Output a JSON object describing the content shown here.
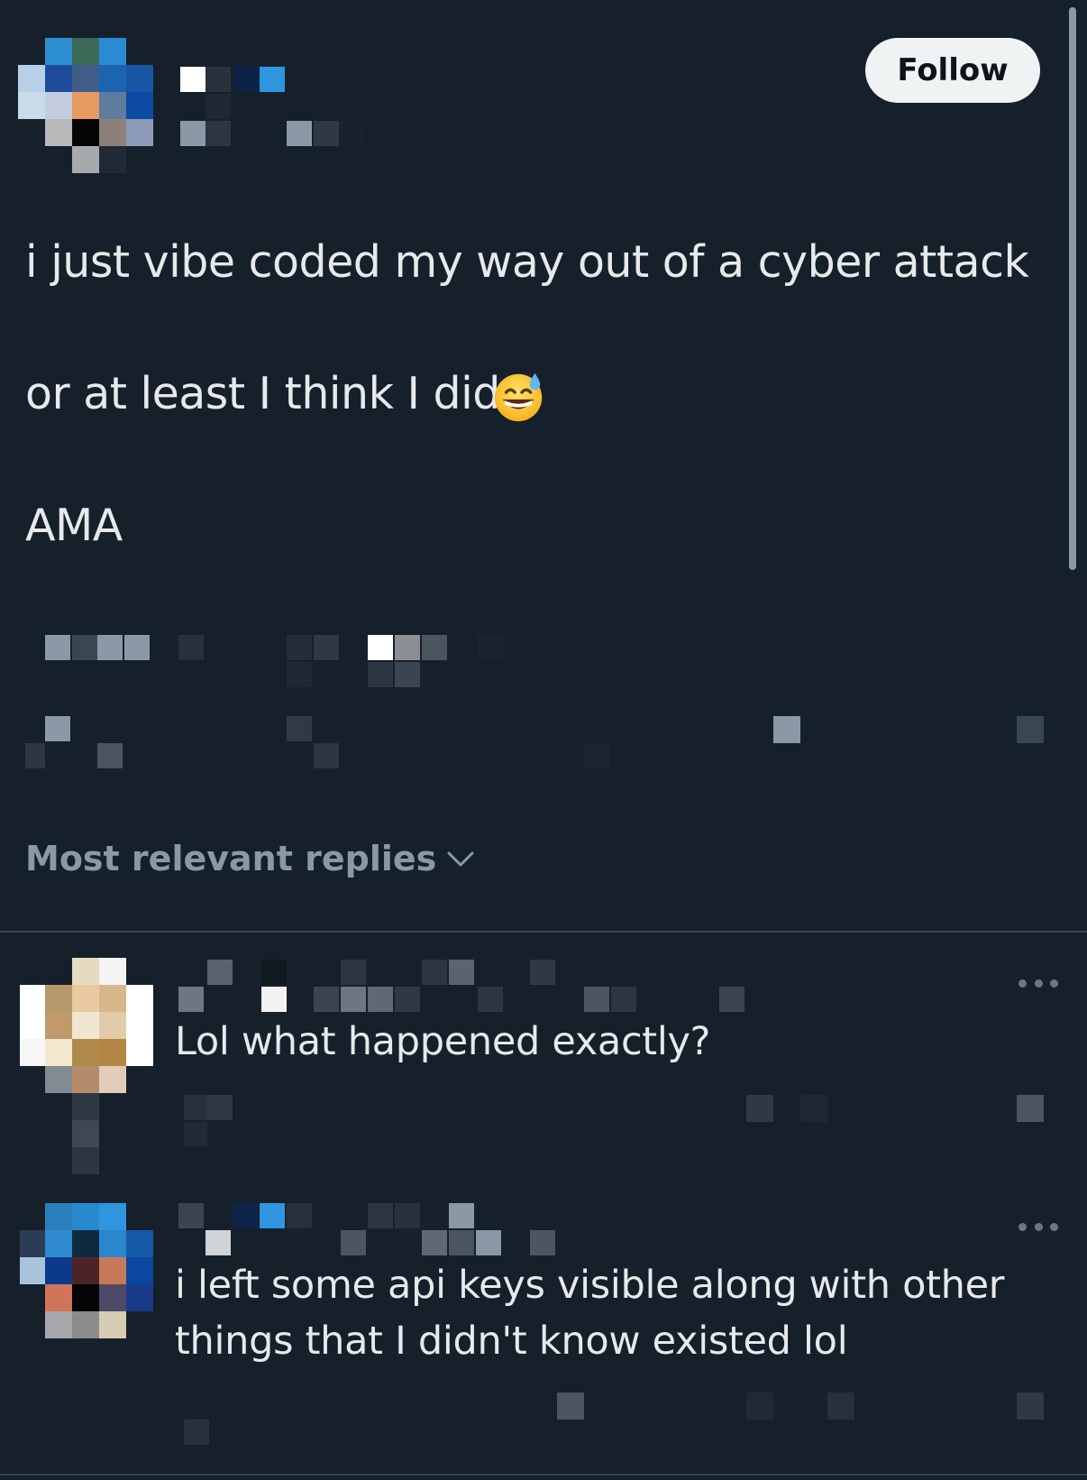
{
  "post": {
    "follow_label": "Follow",
    "lines": [
      "i just vibe coded my way out of a cyber attack",
      "or at least I think I did",
      "AMA"
    ],
    "emoji": "grinning-face-with-sweat-icon"
  },
  "replies_sort": {
    "label": "Most relevant replies",
    "icon": "chevron-down-icon"
  },
  "replies": [
    {
      "text": "Lol what happened exactly?"
    },
    {
      "text_lines": [
        "i left some api keys visible along with other",
        "things that I didn't know existed lol"
      ]
    }
  ],
  "colors": {
    "background": "#15202b",
    "text": "#e7e9ea",
    "muted": "#8b98a5",
    "divider": "#38444d",
    "follow_bg": "#eff3f4"
  }
}
